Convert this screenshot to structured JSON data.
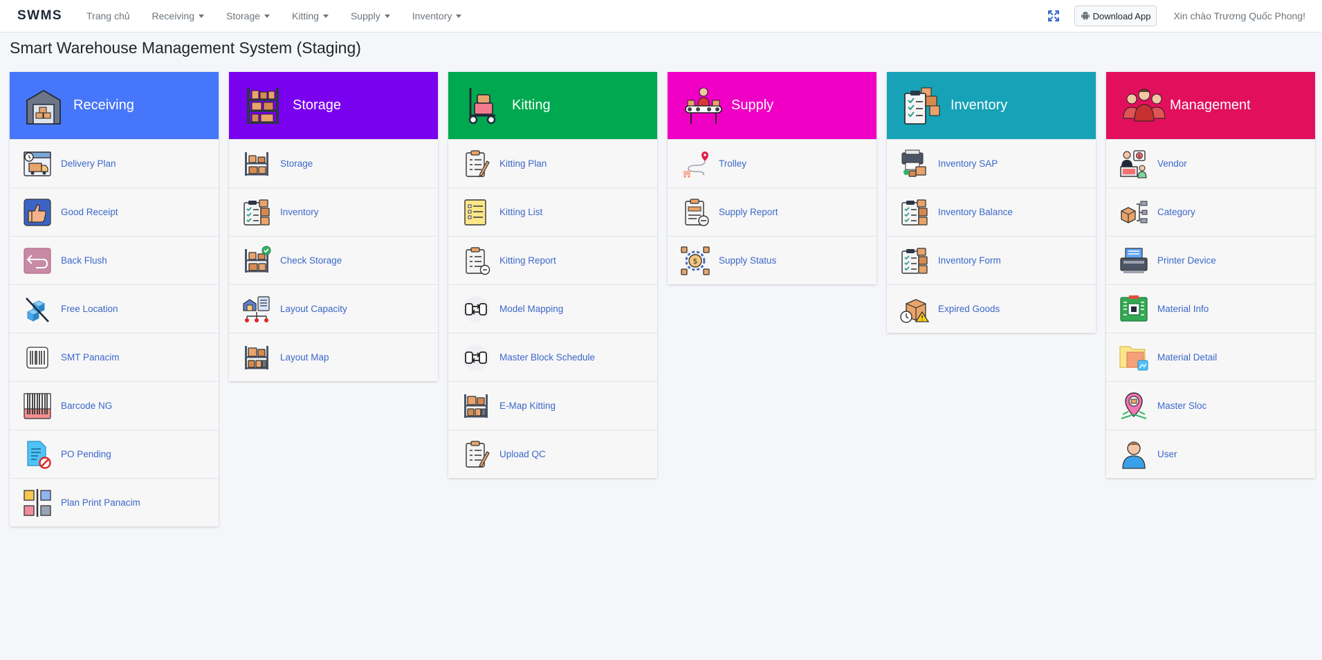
{
  "navbar": {
    "brand": "SWMS",
    "items": [
      {
        "label": "Trang chủ",
        "dropdown": false
      },
      {
        "label": "Receiving",
        "dropdown": true
      },
      {
        "label": "Storage",
        "dropdown": true
      },
      {
        "label": "Kitting",
        "dropdown": true
      },
      {
        "label": "Supply",
        "dropdown": true
      },
      {
        "label": "Inventory",
        "dropdown": true
      }
    ],
    "download_label": "Download App",
    "greeting": "Xin chào Trương Quốc Phong!"
  },
  "page_title": "Smart Warehouse Management System (Staging)",
  "columns": [
    {
      "title": "Receiving",
      "color": "#4676fa",
      "icon": "warehouse-icon",
      "items": [
        {
          "label": "Delivery Plan",
          "icon": "delivery-truck-icon"
        },
        {
          "label": "Good Receipt",
          "icon": "thumbs-up-icon"
        },
        {
          "label": "Back Flush",
          "icon": "return-arrow-icon"
        },
        {
          "label": "Free Location",
          "icon": "cubes-icon"
        },
        {
          "label": "SMT Panacim",
          "icon": "barcode-scan-icon"
        },
        {
          "label": "Barcode NG",
          "icon": "barcode-icon"
        },
        {
          "label": "PO Pending",
          "icon": "document-blocked-icon"
        },
        {
          "label": "Plan Print Panacim",
          "icon": "grid-plan-icon"
        }
      ]
    },
    {
      "title": "Storage",
      "color": "#7a00f0",
      "icon": "shelves-icon",
      "items": [
        {
          "label": "Storage",
          "icon": "shelf-boxes-icon"
        },
        {
          "label": "Inventory",
          "icon": "clipboard-boxes-icon"
        },
        {
          "label": "Check Storage",
          "icon": "shelf-check-icon"
        },
        {
          "label": "Layout Capacity",
          "icon": "warehouse-layout-icon"
        },
        {
          "label": "Layout Map",
          "icon": "shelf-map-icon"
        }
      ]
    },
    {
      "title": "Kitting",
      "color": "#00a94f",
      "icon": "hand-trolley-icon",
      "items": [
        {
          "label": "Kitting Plan",
          "icon": "clipboard-pencil-icon"
        },
        {
          "label": "Kitting List",
          "icon": "checklist-icon"
        },
        {
          "label": "Kitting Report",
          "icon": "clipboard-report-icon"
        },
        {
          "label": "Model Mapping",
          "icon": "mapping-icon"
        },
        {
          "label": "Master Block Schedule",
          "icon": "schedule-mapping-icon"
        },
        {
          "label": "E-Map Kitting",
          "icon": "shelf-map-icon"
        },
        {
          "label": "Upload QC",
          "icon": "clipboard-pencil-icon"
        }
      ]
    },
    {
      "title": "Supply",
      "color": "#f000c4",
      "icon": "conveyor-worker-icon",
      "items": [
        {
          "label": "Trolley",
          "icon": "route-pin-icon"
        },
        {
          "label": "Supply Report",
          "icon": "clipboard-truck-icon"
        },
        {
          "label": "Supply Status",
          "icon": "gear-dollar-icon"
        }
      ]
    },
    {
      "title": "Inventory",
      "color": "#17a2b8",
      "icon": "checklist-boxes-icon",
      "items": [
        {
          "label": "Inventory SAP",
          "icon": "printer-boxes-icon"
        },
        {
          "label": "Inventory Balance",
          "icon": "clipboard-boxes-icon"
        },
        {
          "label": "Inventory Form",
          "icon": "clipboard-boxes-icon"
        },
        {
          "label": "Expired Goods",
          "icon": "box-warning-icon"
        }
      ]
    },
    {
      "title": "Management",
      "color": "#e20f5c",
      "icon": "team-icon",
      "items": [
        {
          "label": "Vendor",
          "icon": "vendor-icon"
        },
        {
          "label": "Category",
          "icon": "category-tree-icon"
        },
        {
          "label": "Printer Device",
          "icon": "printer-icon"
        },
        {
          "label": "Material Info",
          "icon": "chip-board-icon"
        },
        {
          "label": "Material Detail",
          "icon": "folder-image-icon"
        },
        {
          "label": "Master Sloc",
          "icon": "location-pin-icon"
        },
        {
          "label": "User",
          "icon": "user-icon"
        }
      ]
    }
  ]
}
